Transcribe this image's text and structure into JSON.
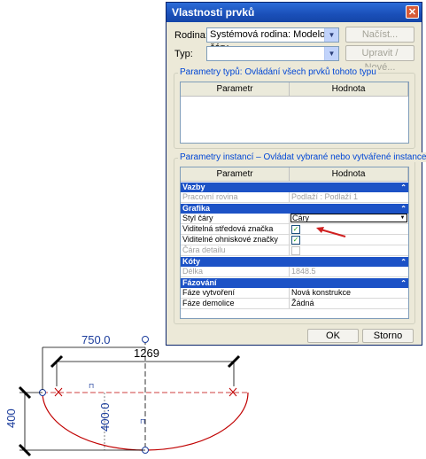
{
  "dialog": {
    "title": "Vlastnosti prvků",
    "family_label": "Rodina:",
    "family_value": "Systémová rodina: Modelové čáry",
    "type_label": "Typ:",
    "type_value": "",
    "load_button": "Načíst...",
    "edit_button": "Upravit / Nové...",
    "type_params_title": "Parametry typů: Ovládání všech prvků tohoto typu",
    "type_params_headers": [
      "Parametr",
      "Hodnota"
    ],
    "instance_params_title": "Parametry instancí – Ovládat vybrané nebo vytvářené instance",
    "instance_params_headers": [
      "Parametr",
      "Hodnota"
    ],
    "sections": [
      {
        "name": "Vazby",
        "rows": [
          {
            "param": "Pracovní rovina",
            "value": "Podlaží : Podlaží 1",
            "disabled": true
          }
        ]
      },
      {
        "name": "Grafika",
        "rows": [
          {
            "param": "Styl čáry",
            "value": "Čáry"
          },
          {
            "param": "Viditelná středová značka",
            "value": "checked"
          },
          {
            "param": "Viditelné ohniskové značky",
            "value": "checked"
          },
          {
            "param": "Čára detailu",
            "value": "unchecked",
            "disabled": true
          }
        ]
      },
      {
        "name": "Kóty",
        "rows": [
          {
            "param": "Délka",
            "value": "1848.5",
            "disabled": true
          }
        ]
      },
      {
        "name": "Fázování",
        "rows": [
          {
            "param": "Fáze vytvoření",
            "value": "Nová konstrukce"
          },
          {
            "param": "Fáze demolice",
            "value": "Žádná"
          }
        ]
      }
    ],
    "ok_button": "OK",
    "cancel_button": "Storno"
  },
  "drawing": {
    "dim_radius_top": "750.0",
    "dim_width": "1269",
    "dim_height_left": "400",
    "dim_radius_vertical": "400.0"
  },
  "colors": {
    "title_bar": "#1a4fb8",
    "section_header": "#1c52c6",
    "arc": "#c00000",
    "dimension_blue": "#1c3d9c",
    "arrow": "#d02020"
  }
}
